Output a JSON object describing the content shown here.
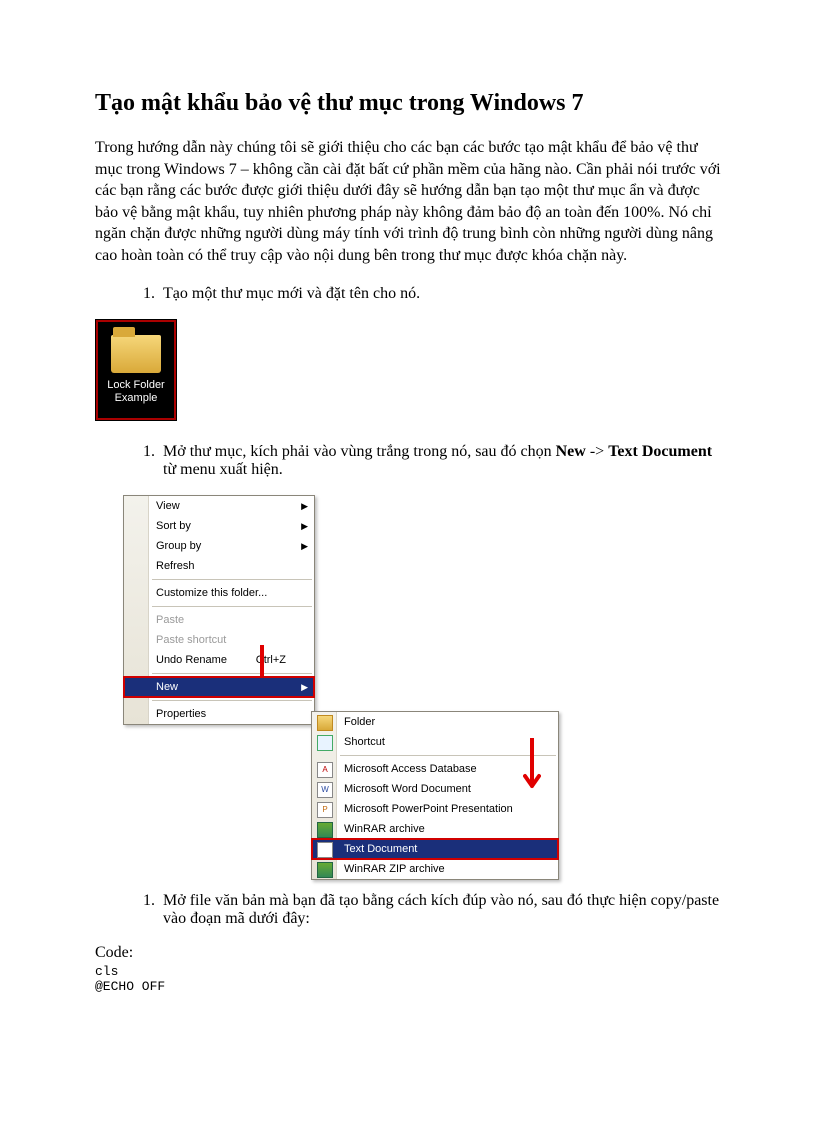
{
  "title": "Tạo mật khẩu bảo vệ thư mục trong Windows 7",
  "intro": "Trong hướng dẫn này chúng tôi sẽ giới thiệu cho các bạn các bước tạo mật khẩu để bảo vệ thư mục trong Windows 7 – không cần cài đặt bất cứ phần mềm của hãng nào. Cần phải nói trước với các bạn rằng các bước được giới thiệu dưới đây sẽ hướng dẫn bạn tạo một thư mục ẩn và được bảo vệ bằng mật khẩu, tuy nhiên phương pháp này không đảm bảo độ an toàn đến 100%. Nó chỉ ngăn chặn được những người dùng máy tính với trình độ trung bình còn những người dùng nâng cao hoàn toàn có thể truy cập vào nội dung bên trong thư mục được khóa chặn này.",
  "step1": "Tạo một thư mục mới và đặt tên cho nó.",
  "folder_label_l1": "Lock Folder",
  "folder_label_l2": "Example",
  "step2_pre": "Mở thư mục, kích phải vào vùng trắng trong nó, sau đó chọn ",
  "step2_b1": "New",
  "step2_mid": " -> ",
  "step2_b2": "Text Document",
  "step2_post": " từ menu xuất hiện.",
  "menu_main": {
    "view": "View",
    "sortby": "Sort by",
    "groupby": "Group by",
    "refresh": "Refresh",
    "customize": "Customize this folder...",
    "paste": "Paste",
    "paste_shortcut": "Paste shortcut",
    "undo_rename": "Undo Rename",
    "undo_shortcut": "Ctrl+Z",
    "new": "New",
    "properties": "Properties"
  },
  "menu_sub": {
    "folder": "Folder",
    "shortcut": "Shortcut",
    "access": "Microsoft Access Database",
    "word": "Microsoft Word Document",
    "ppt": "Microsoft PowerPoint Presentation",
    "rar": "WinRAR archive",
    "text": "Text Document",
    "zip": "WinRAR ZIP archive"
  },
  "step3": "Mở file văn bản mà bạn đã tạo bằng cách kích đúp vào nó, sau đó thực hiện copy/paste vào đoạn mã dưới đây:",
  "code_label": "Code:",
  "code_body": "cls\n@ECHO OFF"
}
